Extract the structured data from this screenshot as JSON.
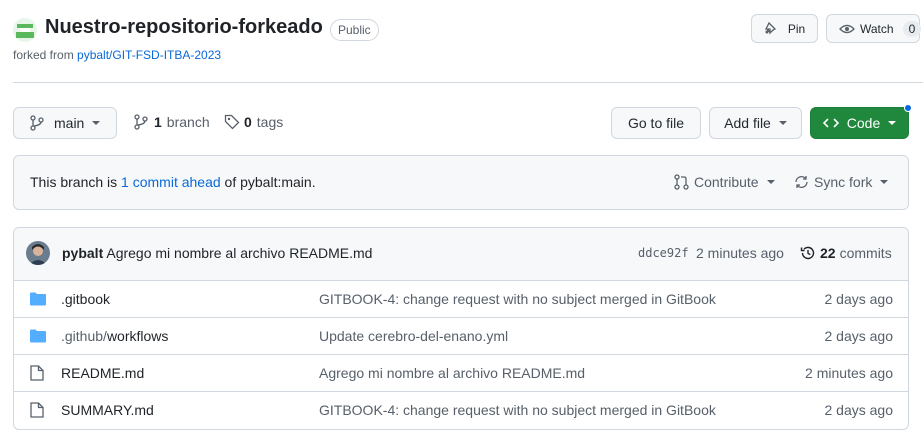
{
  "repo": {
    "name": "Nuestro-repositorio-forkeado",
    "visibility": "Public",
    "forked_prefix": "forked from",
    "forked_from": "pybalt/GIT-FSD-ITBA-2023"
  },
  "header_actions": {
    "pin_label": "Pin",
    "watch_label": "Watch",
    "watch_count": "0"
  },
  "toolbar": {
    "branch_name": "main",
    "branches_count": "1",
    "branches_label": "branch",
    "tags_count": "0",
    "tags_label": "tags",
    "go_to_file": "Go to file",
    "add_file": "Add file",
    "code": "Code"
  },
  "fork_status": {
    "prefix": "This branch is",
    "ahead_link": "1 commit ahead",
    "suffix": "of pybalt:main.",
    "contribute": "Contribute",
    "sync_fork": "Sync fork"
  },
  "latest_commit": {
    "author": "pybalt",
    "message": "Agrego mi nombre al archivo README.md",
    "sha": "ddce92f",
    "time": "2 minutes ago",
    "commits_count": "22",
    "commits_label": "commits"
  },
  "files": [
    {
      "type": "folder",
      "name": ".gitbook",
      "message": "GITBOOK-4: change request with no subject merged in GitBook",
      "age": "2 days ago"
    },
    {
      "type": "folder",
      "name_prefix": ".github/",
      "name": "workflows",
      "message": "Update cerebro-del-enano.yml",
      "age": "2 days ago"
    },
    {
      "type": "file",
      "name": "README.md",
      "message": "Agrego mi nombre al archivo README.md",
      "age": "2 minutes ago"
    },
    {
      "type": "file",
      "name": "SUMMARY.md",
      "message": "GITBOOK-4: change request with no subject merged in GitBook",
      "age": "2 days ago"
    }
  ],
  "colors": {
    "accent": "#0969da",
    "code_button": "#1f883d",
    "folder": "#54aeff",
    "border": "#d0d7de"
  }
}
